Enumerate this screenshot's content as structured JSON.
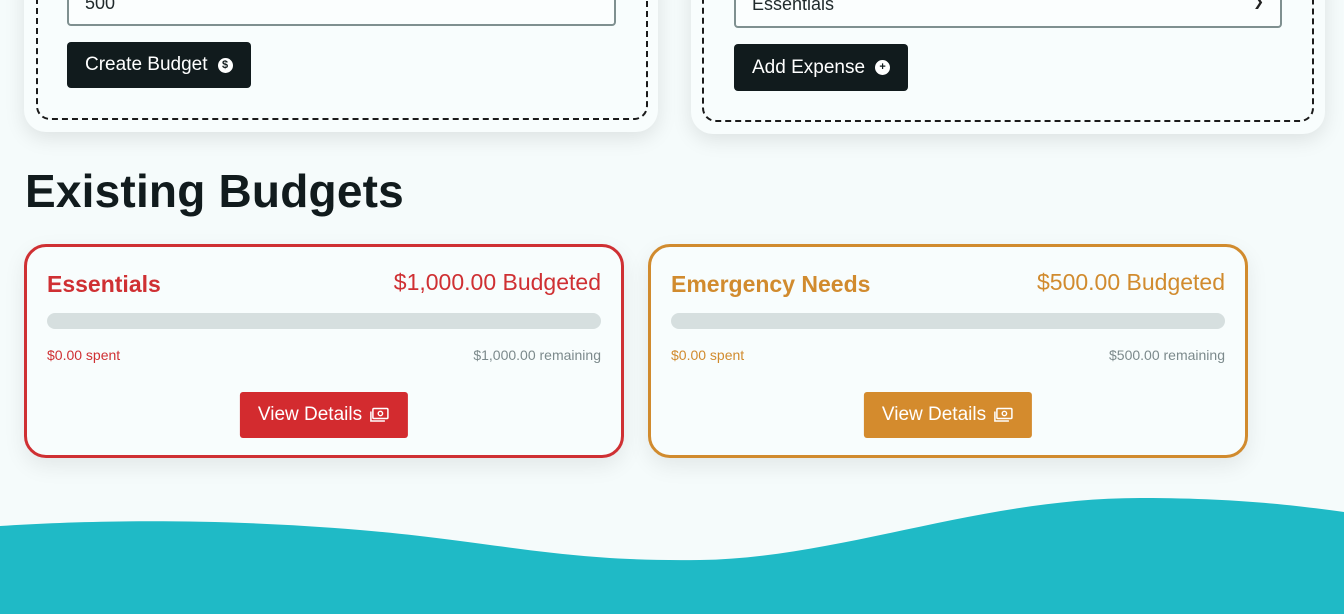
{
  "budget_form": {
    "amount_value": "500",
    "submit_label": "Create Budget"
  },
  "expense_form": {
    "category_value": "Essentials",
    "submit_label": "Add Expense"
  },
  "existing_budgets": {
    "title": "Existing Budgets",
    "items": [
      {
        "name": "Essentials",
        "budgeted": "$1,000.00 Budgeted",
        "spent": "$0.00 spent",
        "remaining": "$1,000.00 remaining",
        "progress": 0,
        "button_label": "View Details",
        "color": "#cf3033"
      },
      {
        "name": "Emergency Needs",
        "budgeted": "$500.00 Budgeted",
        "spent": "$0.00 spent",
        "remaining": "$500.00 remaining",
        "progress": 0,
        "button_label": "View Details",
        "color": "#d18b2e"
      }
    ]
  },
  "theme": {
    "background": "#f5fbfb",
    "dark": "#111b1d",
    "wave": "#1fbac6"
  }
}
